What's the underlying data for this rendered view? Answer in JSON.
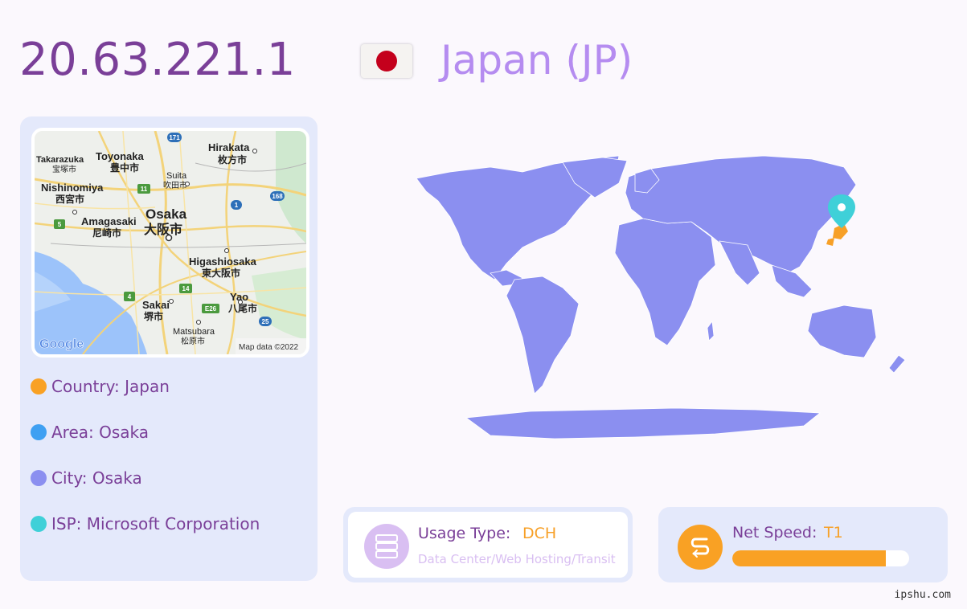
{
  "header": {
    "ip": "20.63.221.1",
    "country_title": "Japan (JP)",
    "flag_icon": "japan-flag-icon"
  },
  "map_thumbnail": {
    "labels": [
      {
        "id": "takarazuka",
        "en": "Takarazuka",
        "jp": "宝塚市"
      },
      {
        "id": "toyonaka",
        "en": "Toyonaka",
        "jp": "豊中市"
      },
      {
        "id": "hirakata",
        "en": "Hirakata",
        "jp": "枚方市"
      },
      {
        "id": "suita",
        "en": "Suita",
        "jp": "吹田市"
      },
      {
        "id": "nishinomiya",
        "en": "Nishinomiya",
        "jp": "西宮市"
      },
      {
        "id": "amagasaki",
        "en": "Amagasaki",
        "jp": "尼崎市"
      },
      {
        "id": "osaka",
        "en": "Osaka",
        "jp": "大阪市"
      },
      {
        "id": "higashiosaka",
        "en": "Higashiosaka",
        "jp": "東大阪市"
      },
      {
        "id": "yao",
        "en": "Yao",
        "jp": "八尾市"
      },
      {
        "id": "sakai",
        "en": "Sakai",
        "jp": "堺市"
      },
      {
        "id": "matsubara",
        "en": "Matsubara",
        "jp": "松原市"
      }
    ],
    "route_badges": [
      "171",
      "11",
      "168",
      "1",
      "5",
      "14",
      "4",
      "E26",
      "25"
    ],
    "logo": "Google",
    "attribution": "Map data ©2022"
  },
  "info": {
    "country": "Country: Japan",
    "area": "Area: Osaka",
    "city": "City: Osaka",
    "isp": "ISP: Microsoft Corporation"
  },
  "colors": {
    "country_dot": "#f9a124",
    "area_dot": "#3fa0f2",
    "city_dot": "#8b8ff0",
    "isp_dot": "#3fd0d8",
    "land": "#8b8ff0",
    "highlight": "#f7a027",
    "pin": "#3fd0d8"
  },
  "usage": {
    "label": "Usage Type:",
    "value": "DCH",
    "description": "Data Center/Web Hosting/Transit",
    "icon": "server-icon"
  },
  "speed": {
    "label": "Net Speed:",
    "value": "T1",
    "level": 0.87,
    "icon": "speed-icon"
  },
  "watermark": "ipshu.com"
}
